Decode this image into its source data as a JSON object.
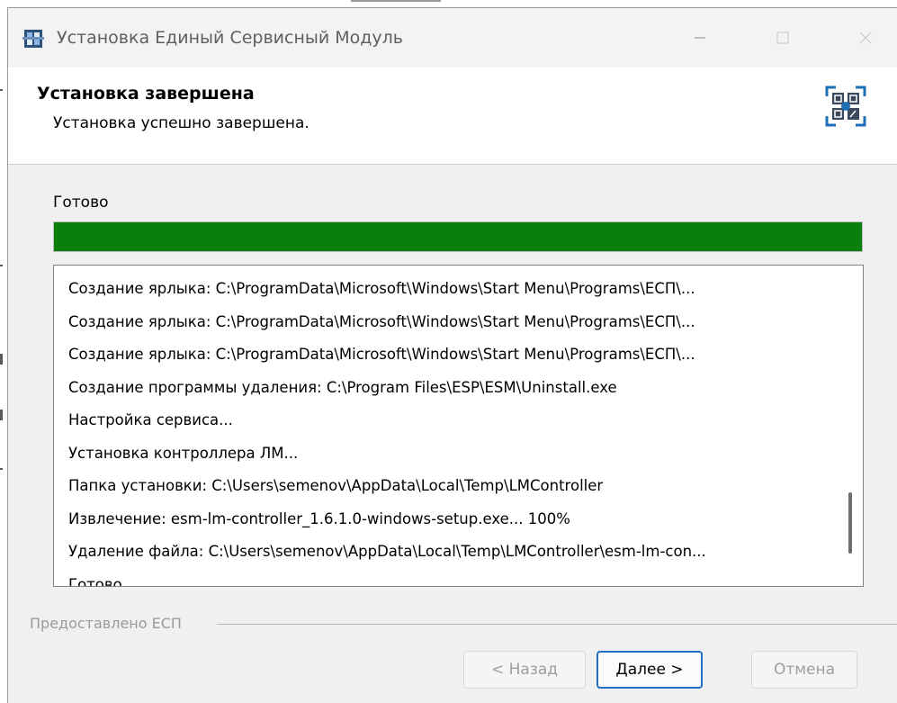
{
  "window": {
    "title": "Установка Единый Сервисный Модуль"
  },
  "header": {
    "title": "Установка завершена",
    "subtitle": "Установка успешно завершена."
  },
  "progress": {
    "label": "Готово",
    "value": 1.0,
    "color": "#0b7f0b"
  },
  "log": {
    "lines": [
      "Создание ярлыка: C:\\ProgramData\\Microsoft\\Windows\\Start Menu\\Programs\\ЕСП\\...",
      "Создание ярлыка: C:\\ProgramData\\Microsoft\\Windows\\Start Menu\\Programs\\ЕСП\\...",
      "Создание ярлыка: C:\\ProgramData\\Microsoft\\Windows\\Start Menu\\Programs\\ЕСП\\...",
      "Создание программы удаления: C:\\Program Files\\ESP\\ESM\\Uninstall.exe",
      "Настройка сервиса...",
      "Установка контроллера ЛМ...",
      "Папка установки: C:\\Users\\semenov\\AppData\\Local\\Temp\\LMController",
      "Извлечение: esm-lm-controller_1.6.1.0-windows-setup.exe... 100%",
      "Удаление файла: C:\\Users\\semenov\\AppData\\Local\\Temp\\LMController\\esm-lm-con...",
      "Готово"
    ]
  },
  "footer": {
    "provided_by": "Предоставлено ЕСП"
  },
  "buttons": {
    "back": "< Назад",
    "next": "Далее >",
    "cancel": "Отмена"
  },
  "colors": {
    "accent": "#1f6fc7",
    "logo": "#1d6fb8"
  },
  "icons": {
    "app": "installer-app-icon",
    "logo": "esm-logo-icon"
  }
}
